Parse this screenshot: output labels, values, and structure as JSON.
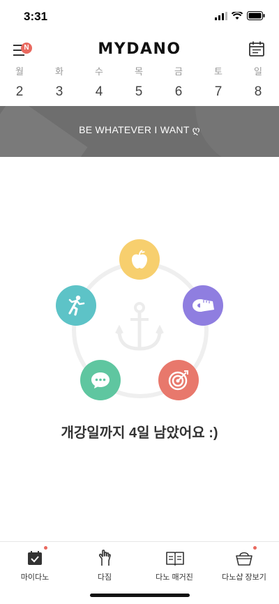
{
  "status_bar": {
    "time": "3:31"
  },
  "header": {
    "brand": "MYDANO",
    "menu_badge": "N"
  },
  "week": [
    {
      "name": "월",
      "num": "2"
    },
    {
      "name": "화",
      "num": "3"
    },
    {
      "name": "수",
      "num": "4"
    },
    {
      "name": "목",
      "num": "5"
    },
    {
      "name": "금",
      "num": "6"
    },
    {
      "name": "토",
      "num": "7"
    },
    {
      "name": "일",
      "num": "8"
    }
  ],
  "banner": {
    "text": "BE WHATEVER I WANT ღ"
  },
  "goals": [
    {
      "icon": "apple-icon",
      "color": "#f7cf6e"
    },
    {
      "icon": "tape-measure-icon",
      "color": "#8f7ee0"
    },
    {
      "icon": "target-icon",
      "color": "#e8786c"
    },
    {
      "icon": "chat-bubble-icon",
      "color": "#5fc6a0"
    },
    {
      "icon": "running-person-icon",
      "color": "#5dc3c7"
    }
  ],
  "countdown": "개강일까지 4일 남았어요 :)",
  "tabs": [
    {
      "label": "마이다노",
      "icon": "calendar-check-icon",
      "dot": true
    },
    {
      "label": "다짐",
      "icon": "hand-promise-icon",
      "dot": false
    },
    {
      "label": "다노 매거진",
      "icon": "book-icon",
      "dot": false
    },
    {
      "label": "다노샵 장보기",
      "icon": "basket-icon",
      "dot": true
    }
  ],
  "colors": {
    "accent": "#e9695f",
    "banner": "#6e6e6e"
  }
}
